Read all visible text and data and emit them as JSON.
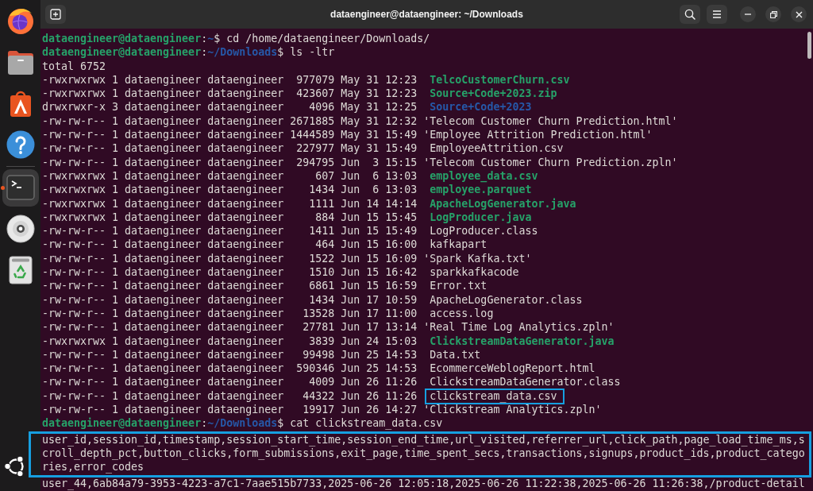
{
  "window": {
    "title": "dataengineer@dataengineer: ~/Downloads"
  },
  "dock": {
    "groups": [
      {
        "items": [
          {
            "kind": "browser",
            "active": false
          },
          {
            "kind": "files",
            "active": false
          },
          {
            "kind": "app-store",
            "active": false
          },
          {
            "kind": "help",
            "active": false
          }
        ]
      },
      {
        "items": [
          {
            "kind": "terminal",
            "active": true
          },
          {
            "kind": "disc",
            "active": false
          },
          {
            "kind": "trash",
            "active": false
          }
        ]
      }
    ]
  },
  "terminal": {
    "lines": [
      {
        "kind": "prompt",
        "user": "dataengineer@dataengineer",
        "separator": ":",
        "path": "~",
        "symbol": "$",
        "command": "cd /home/dataengineer/Downloads/"
      },
      {
        "kind": "prompt",
        "user": "dataengineer@dataengineer",
        "separator": ":",
        "path": "~/Downloads",
        "symbol": "$",
        "command": "ls -ltr"
      },
      {
        "kind": "output",
        "highlighted": false,
        "lines": [
          "total 6752"
        ]
      },
      {
        "kind": "executable",
        "details": "-rwxrwxrwx 1 dataengineer dataengineer  977079 May 31 12:23",
        "name": "TelcoCustomerChurn.csv",
        "highlighted": false
      },
      {
        "kind": "executable",
        "details": "-rwxrwxrwx 1 dataengineer dataengineer  423607 May 31 12:23",
        "name": "Source+Code+2023.zip",
        "highlighted": false
      },
      {
        "kind": "directory",
        "details": "drwxrwxr-x 3 dataengineer dataengineer    4096 May 31 12:25",
        "name": "Source+Code+2023",
        "highlighted": false
      },
      {
        "kind": "file",
        "details": "-rw-rw-r-- 1 dataengineer dataengineer 2671885 May 31 12:32",
        "quote": "'",
        "name": "Telecom Customer Churn Prediction.html",
        "highlighted": false
      },
      {
        "kind": "file",
        "details": "-rw-rw-r-- 1 dataengineer dataengineer 1444589 May 31 15:49",
        "quote": "'",
        "name": "Employee Attrition Prediction.html",
        "highlighted": false
      },
      {
        "kind": "file",
        "details": "-rw-rw-r-- 1 dataengineer dataengineer  227977 May 31 15:49",
        "name": "EmployeeAttrition.csv",
        "highlighted": false
      },
      {
        "kind": "file",
        "details": "-rw-rw-r-- 1 dataengineer dataengineer  294795 Jun  3 15:15",
        "quote": "'",
        "name": "Telecom Customer Churn Prediction.zpln",
        "highlighted": false
      },
      {
        "kind": "executable",
        "details": "-rwxrwxrwx 1 dataengineer dataengineer     607 Jun  6 13:03",
        "name": "employee_data.csv",
        "highlighted": false
      },
      {
        "kind": "executable",
        "details": "-rwxrwxrwx 1 dataengineer dataengineer    1434 Jun  6 13:03",
        "name": "employee.parquet",
        "highlighted": false
      },
      {
        "kind": "executable",
        "details": "-rwxrwxrwx 1 dataengineer dataengineer    1111 Jun 14 14:14",
        "name": "ApacheLogGenerator.java",
        "highlighted": false
      },
      {
        "kind": "executable",
        "details": "-rwxrwxrwx 1 dataengineer dataengineer     884 Jun 15 15:45",
        "name": "LogProducer.java",
        "highlighted": false
      },
      {
        "kind": "file",
        "details": "-rw-rw-r-- 1 dataengineer dataengineer    1411 Jun 15 15:49",
        "name": "LogProducer.class",
        "highlighted": false
      },
      {
        "kind": "file",
        "details": "-rw-rw-r-- 1 dataengineer dataengineer     464 Jun 15 16:00",
        "name": "kafkapart",
        "highlighted": false
      },
      {
        "kind": "file",
        "details": "-rw-rw-r-- 1 dataengineer dataengineer    1522 Jun 15 16:09",
        "quote": "'",
        "name": "Spark Kafka.txt",
        "highlighted": false
      },
      {
        "kind": "file",
        "details": "-rw-rw-r-- 1 dataengineer dataengineer    1510 Jun 15 16:42",
        "name": "sparkkafkacode",
        "highlighted": false
      },
      {
        "kind": "file",
        "details": "-rw-rw-r-- 1 dataengineer dataengineer    6861 Jun 15 16:59",
        "name": "Error.txt",
        "highlighted": false
      },
      {
        "kind": "file",
        "details": "-rw-rw-r-- 1 dataengineer dataengineer    1434 Jun 17 10:59",
        "name": "ApacheLogGenerator.class",
        "highlighted": false
      },
      {
        "kind": "file",
        "details": "-rw-rw-r-- 1 dataengineer dataengineer   13528 Jun 17 11:00",
        "name": "access.log",
        "highlighted": false
      },
      {
        "kind": "file",
        "details": "-rw-rw-r-- 1 dataengineer dataengineer   27781 Jun 17 13:14",
        "quote": "'",
        "name": "Real Time Log Analytics.zpln",
        "highlighted": false
      },
      {
        "kind": "executable",
        "details": "-rwxrwxrwx 1 dataengineer dataengineer    3839 Jun 24 15:03",
        "name": "ClickstreamDataGenerator.java",
        "highlighted": false
      },
      {
        "kind": "file",
        "details": "-rw-rw-r-- 1 dataengineer dataengineer   99498 Jun 25 14:53",
        "name": "Data.txt",
        "highlighted": false
      },
      {
        "kind": "file",
        "details": "-rw-rw-r-- 1 dataengineer dataengineer  590346 Jun 25 14:53",
        "name": "EcommerceWeblogReport.html",
        "highlighted": false
      },
      {
        "kind": "file",
        "details": "-rw-rw-r-- 1 dataengineer dataengineer    4009 Jun 26 11:26",
        "name": "ClickstreamDataGenerator.class",
        "highlighted": false
      },
      {
        "kind": "file",
        "details": "-rw-rw-r-- 1 dataengineer dataengineer   44322 Jun 26 11:26",
        "name": "clickstream_data.csv",
        "highlighted": true
      },
      {
        "kind": "file",
        "details": "-rw-rw-r-- 1 dataengineer dataengineer   19917 Jun 26 14:27",
        "quote": "'",
        "name": "Clickstream Analytics.zpln",
        "highlighted": false
      },
      {
        "kind": "prompt",
        "user": "dataengineer@dataengineer",
        "separator": ":",
        "path": "~/Downloads",
        "symbol": "$",
        "command": "cat clickstream_data.csv"
      },
      {
        "kind": "output",
        "highlighted": true,
        "lines": [
          "user_id,session_id,timestamp,session_start_time,session_end_time,url_visited,referrer_url,click_path,page_load_time_ms,s",
          "croll_depth_pct,button_clicks,form_submissions,exit_page,time_spent_secs,transactions,signups,product_ids,product_catego",
          "ries,error_codes"
        ]
      },
      {
        "kind": "output",
        "highlighted": false,
        "lines": [
          "user_44,6ab84a79-3953-4223-a7c1-7aae515b7733,2025-06-26 12:05:18,2025-06-26 11:22:38,2025-06-26 11:26:38,/product-detail"
        ]
      }
    ]
  }
}
